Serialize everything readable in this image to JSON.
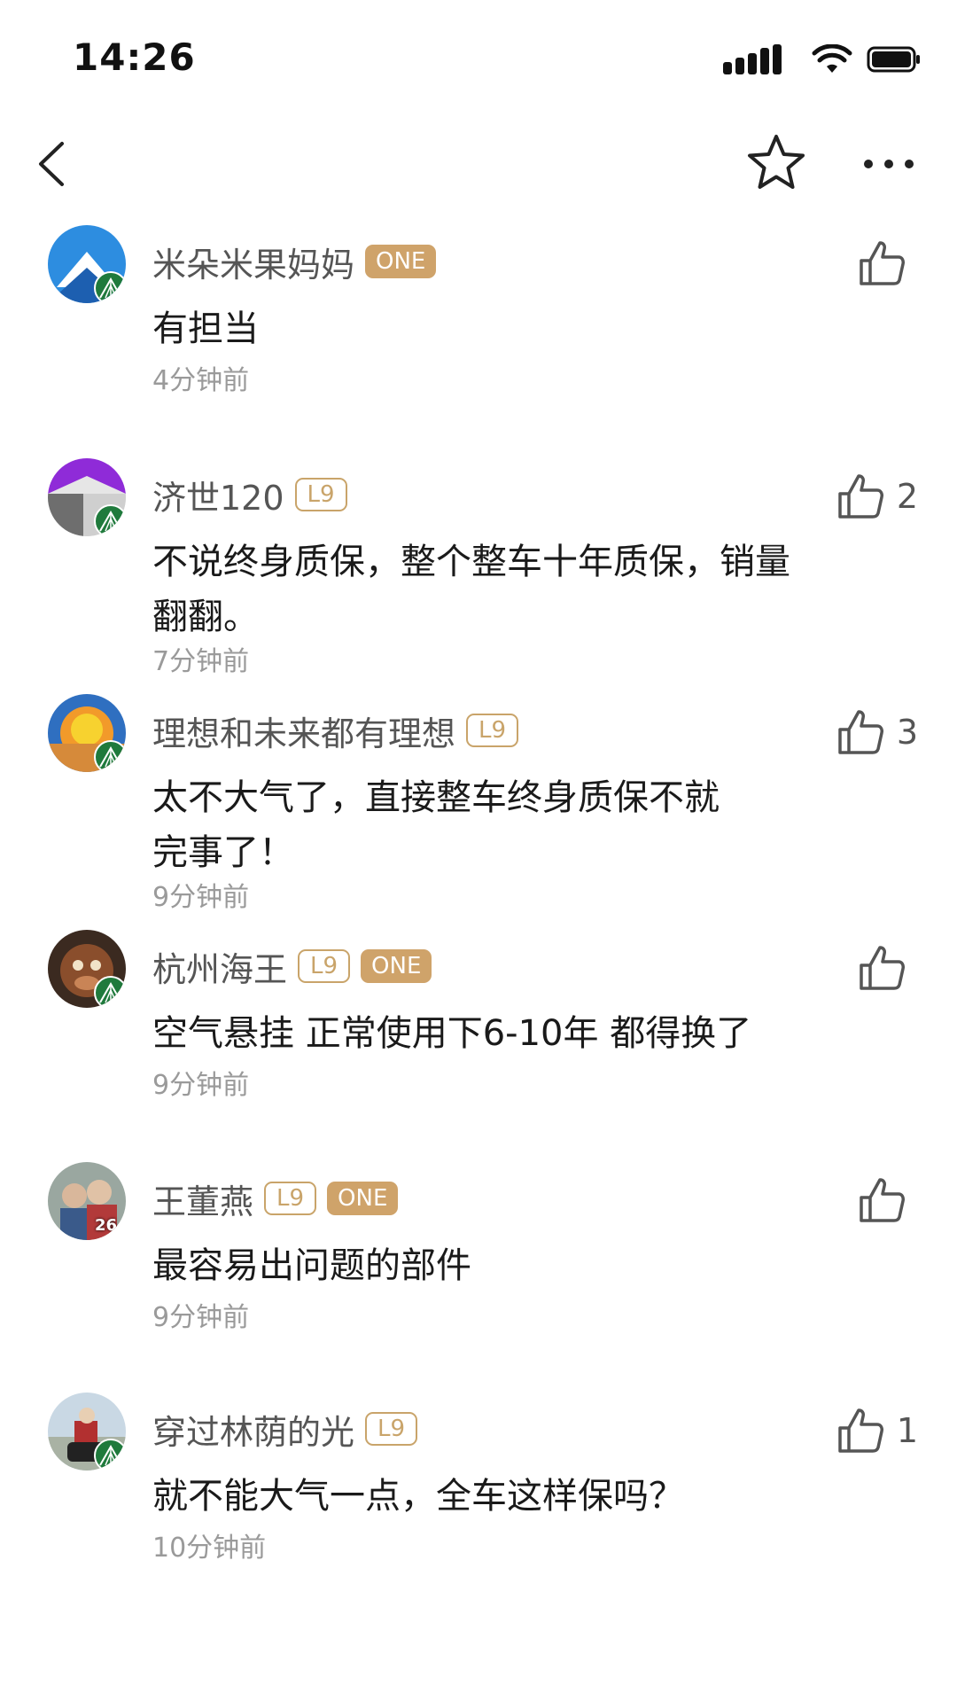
{
  "status_bar": {
    "time": "14:26",
    "icons": [
      "cellular-signal-icon",
      "wifi-icon",
      "battery-icon"
    ]
  },
  "nav": {
    "icons": [
      "back-icon",
      "star-icon",
      "more-icon"
    ]
  },
  "comments": [
    {
      "username": "米朵米果妈妈",
      "badges": [
        "ONE"
      ],
      "text": "有担当",
      "time": "4分钟前",
      "likes": ""
    },
    {
      "username": "济世120",
      "badges": [
        "L9"
      ],
      "text": "不说终身质保，整个整车十年质保，销量\n翻翻。",
      "time": "7分钟前",
      "likes": "2"
    },
    {
      "username": "理想和未来都有理想",
      "badges": [
        "L9"
      ],
      "text": "太不大气了，直接整车终身质保不就\n完事了！",
      "time": "9分钟前",
      "likes": "3"
    },
    {
      "username": "杭州海王",
      "badges": [
        "L9",
        "ONE"
      ],
      "text": "空气悬挂 正常使用下6-10年 都得换了",
      "time": "9分钟前",
      "likes": ""
    },
    {
      "username": "王董燕",
      "badges": [
        "L9",
        "ONE"
      ],
      "text": "最容易出问题的部件",
      "time": "9分钟前",
      "likes": "",
      "avatar_overlay": "26"
    },
    {
      "username": "穿过林荫的光",
      "badges": [
        "L9"
      ],
      "text": "就不能大气一点，全车这样保吗？",
      "time": "10分钟前",
      "likes": "1"
    }
  ],
  "colors": {
    "badge_gold": "#cfa36a",
    "text_gray": "#9a9a9a"
  }
}
